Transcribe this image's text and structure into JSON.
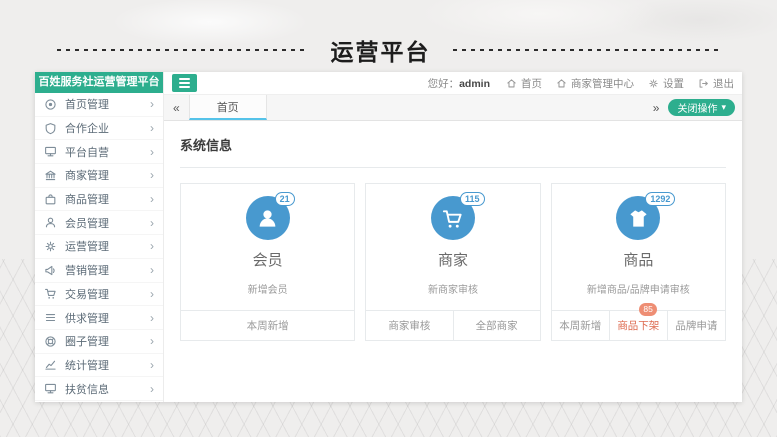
{
  "page": {
    "title": "运营平台"
  },
  "sidebar": {
    "brand": "百姓服务社运营管理平台",
    "items": [
      {
        "icon": "dashboard",
        "label": "首页管理"
      },
      {
        "icon": "shield",
        "label": "合作企业"
      },
      {
        "icon": "monitor",
        "label": "平台自营"
      },
      {
        "icon": "bank",
        "label": "商家管理"
      },
      {
        "icon": "bag",
        "label": "商品管理"
      },
      {
        "icon": "user",
        "label": "会员管理"
      },
      {
        "icon": "gears",
        "label": "运营管理"
      },
      {
        "icon": "bullhorn",
        "label": "营销管理"
      },
      {
        "icon": "cart",
        "label": "交易管理"
      },
      {
        "icon": "list",
        "label": "供求管理"
      },
      {
        "icon": "ring",
        "label": "圈子管理"
      },
      {
        "icon": "chart",
        "label": "统计管理"
      },
      {
        "icon": "monitor",
        "label": "扶贫信息"
      }
    ]
  },
  "topbar": {
    "greeting_prefix": "您好：",
    "username": "admin",
    "links": [
      {
        "icon": "home",
        "label": "首页"
      },
      {
        "icon": "home",
        "label": "商家管理中心"
      },
      {
        "icon": "gears",
        "label": "设置"
      },
      {
        "icon": "signout",
        "label": "退出"
      }
    ]
  },
  "tabs": {
    "active": "首页",
    "close_button": "关闭操作"
  },
  "content": {
    "section_title": "系统信息",
    "cards": [
      {
        "icon": "user-fill",
        "badge": "21",
        "title": "会员",
        "subtitle": "新增会员",
        "footer": [
          {
            "label": "本周新增"
          }
        ]
      },
      {
        "icon": "cart",
        "badge": "115",
        "title": "商家",
        "subtitle": "新商家审核",
        "footer": [
          {
            "label": "商家审核"
          },
          {
            "label": "全部商家"
          }
        ]
      },
      {
        "icon": "tshirt-fill",
        "badge": "1292",
        "title": "商品",
        "subtitle": "新增商品/品牌申请审核",
        "footer": [
          {
            "label": "本周新增"
          },
          {
            "label": "商品下架",
            "highlight": true,
            "badge": "85"
          },
          {
            "label": "品牌申请"
          }
        ]
      }
    ]
  },
  "colors": {
    "brand_green": "#2dae8e",
    "accent_blue": "#4899cf",
    "tab_underline": "#55c3e9",
    "warn_orange": "#dd6a4f"
  }
}
